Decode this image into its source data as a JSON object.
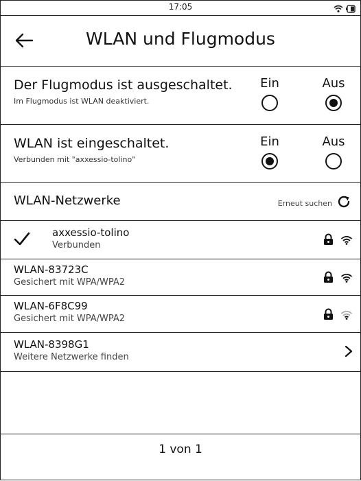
{
  "status_bar": {
    "time": "17:05"
  },
  "header": {
    "title": "WLAN und Flugmodus"
  },
  "flight_mode": {
    "label": "Der Flugmodus ist ausgeschaltet.",
    "subtext": "Im Flugmodus ist WLAN deaktiviert.",
    "on_label": "Ein",
    "off_label": "Aus",
    "selected": "Aus"
  },
  "wlan": {
    "label": "WLAN ist eingeschaltet.",
    "subtext": "Verbunden mit \"axxessio-tolino\"",
    "on_label": "Ein",
    "off_label": "Aus",
    "selected": "Ein"
  },
  "networks": {
    "header": "WLAN-Netzwerke",
    "rescan_label": "Erneut suchen",
    "items": [
      {
        "name": "axxessio-tolino",
        "status": "Verbunden",
        "connected": true,
        "locked": true,
        "signal": "strong"
      },
      {
        "name": "WLAN-83723C",
        "status": "Gesichert mit WPA/WPA2",
        "connected": false,
        "locked": true,
        "signal": "strong"
      },
      {
        "name": "WLAN-6F8C99",
        "status": "Gesichert mit WPA/WPA2",
        "connected": false,
        "locked": true,
        "signal": "weak"
      },
      {
        "name": "WLAN-8398G1",
        "status": "Weitere Netzwerke finden",
        "connected": false,
        "locked": false,
        "signal": "none"
      }
    ]
  },
  "pagination": {
    "text": "1 von 1"
  }
}
